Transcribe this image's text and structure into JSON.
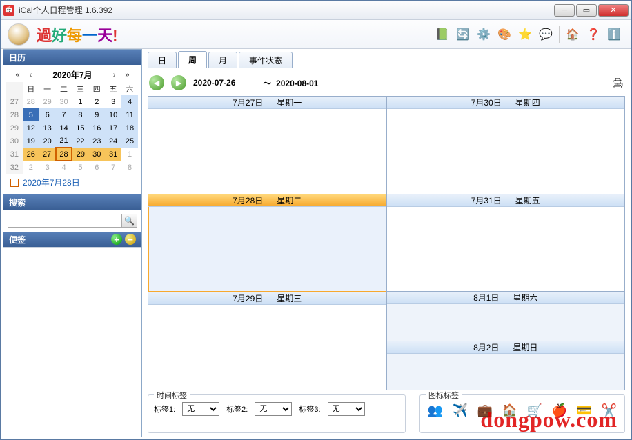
{
  "window": {
    "title": "iCal个人日程管理   1.6.392"
  },
  "slogan": {
    "c1": "過",
    "c2": "好",
    "c3": "每",
    "c4": "一",
    "c5": "天",
    "c6": "!"
  },
  "sidebar": {
    "calendar": {
      "title": "日历",
      "month_label": "2020年7月",
      "weekdays": [
        "日",
        "一",
        "二",
        "三",
        "四",
        "五",
        "六"
      ],
      "weeks": [
        {
          "wk": "27",
          "days": [
            "28",
            "29",
            "30",
            "1",
            "2",
            "3",
            "4"
          ],
          "other": [
            0,
            1,
            2
          ]
        },
        {
          "wk": "28",
          "days": [
            "5",
            "6",
            "7",
            "8",
            "9",
            "10",
            "11"
          ],
          "other": []
        },
        {
          "wk": "29",
          "days": [
            "12",
            "13",
            "14",
            "15",
            "16",
            "17",
            "18"
          ],
          "other": []
        },
        {
          "wk": "30",
          "days": [
            "19",
            "20",
            "21",
            "22",
            "23",
            "24",
            "25"
          ],
          "other": []
        },
        {
          "wk": "31",
          "days": [
            "26",
            "27",
            "28",
            "29",
            "30",
            "31",
            "1"
          ],
          "other": [
            6
          ],
          "selweek": true,
          "today_idx": 2
        },
        {
          "wk": "32",
          "days": [
            "2",
            "3",
            "4",
            "5",
            "6",
            "7",
            "8"
          ],
          "other": [
            0,
            1,
            2,
            3,
            4,
            5,
            6
          ]
        }
      ],
      "today_label": "2020年7月28日"
    },
    "search": {
      "title": "搜索",
      "placeholder": ""
    },
    "notes": {
      "title": "便签"
    }
  },
  "tabs": {
    "day": "日",
    "week": "周",
    "month": "月",
    "status": "事件状态"
  },
  "daterange": {
    "from": "2020-07-26",
    "sep": "～",
    "to": "2020-08-01"
  },
  "weekdays": {
    "left": [
      {
        "date": "7月27日",
        "dow": "星期一"
      },
      {
        "date": "7月28日",
        "dow": "星期二",
        "today": true
      },
      {
        "date": "7月29日",
        "dow": "星期三"
      }
    ],
    "right": [
      {
        "date": "7月30日",
        "dow": "星期四"
      },
      {
        "date": "7月31日",
        "dow": "星期五"
      },
      {
        "date": "8月1日",
        "dow": "星期六",
        "weekend": true
      },
      {
        "date": "8月2日",
        "dow": "星期日",
        "weekend": true
      }
    ]
  },
  "footer": {
    "time_tags": {
      "legend": "时间标签",
      "labels": [
        "标签1:",
        "标签2:",
        "标签3:"
      ],
      "value": "无"
    },
    "icon_tags": {
      "legend": "图标标签"
    }
  },
  "watermark": "dongpow.com"
}
